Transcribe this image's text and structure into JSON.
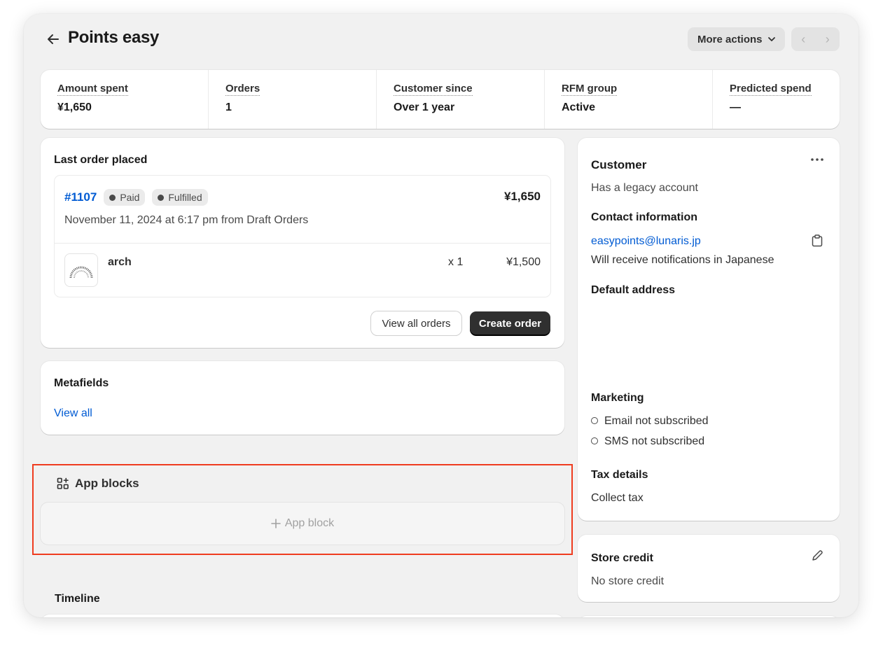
{
  "header": {
    "title": "Points easy",
    "more_actions_label": "More actions",
    "prev_label": "‹",
    "next_label": "›"
  },
  "metrics": [
    {
      "label": "Amount spent",
      "value": "¥1,650"
    },
    {
      "label": "Orders",
      "value": "1"
    },
    {
      "label": "Customer since",
      "value": "Over 1 year"
    },
    {
      "label": "RFM group",
      "value": "Active"
    },
    {
      "label": "Predicted spend",
      "value": "—"
    }
  ],
  "last_order": {
    "title": "Last order placed",
    "order_number": "#1107",
    "badges": [
      "Paid",
      "Fulfilled"
    ],
    "total": "¥1,650",
    "meta": "November 11, 2024 at 6:17 pm from Draft Orders",
    "item": {
      "name": "arch",
      "qty": "x 1",
      "price": "¥1,500"
    },
    "view_all_label": "View all orders",
    "create_label": "Create order"
  },
  "metafields": {
    "title": "Metafields",
    "link": "View all"
  },
  "app_blocks": {
    "title": "App blocks",
    "add_label": "App block"
  },
  "timeline": {
    "title": "Timeline"
  },
  "customer": {
    "title": "Customer",
    "legacy": "Has a legacy account",
    "contact_title": "Contact information",
    "email": "easypoints@lunaris.jp",
    "notifications": "Will receive notifications in Japanese",
    "address_title": "Default address",
    "marketing_title": "Marketing",
    "email_marketing": "Email not subscribed",
    "sms_marketing": "SMS not subscribed",
    "tax_title": "Tax details",
    "tax_value": "Collect tax"
  },
  "store_credit": {
    "title": "Store credit",
    "value": "No store credit"
  },
  "colors": {
    "highlight": "#ef3c1f",
    "link": "#005bd3",
    "primary_button": "#303030"
  }
}
